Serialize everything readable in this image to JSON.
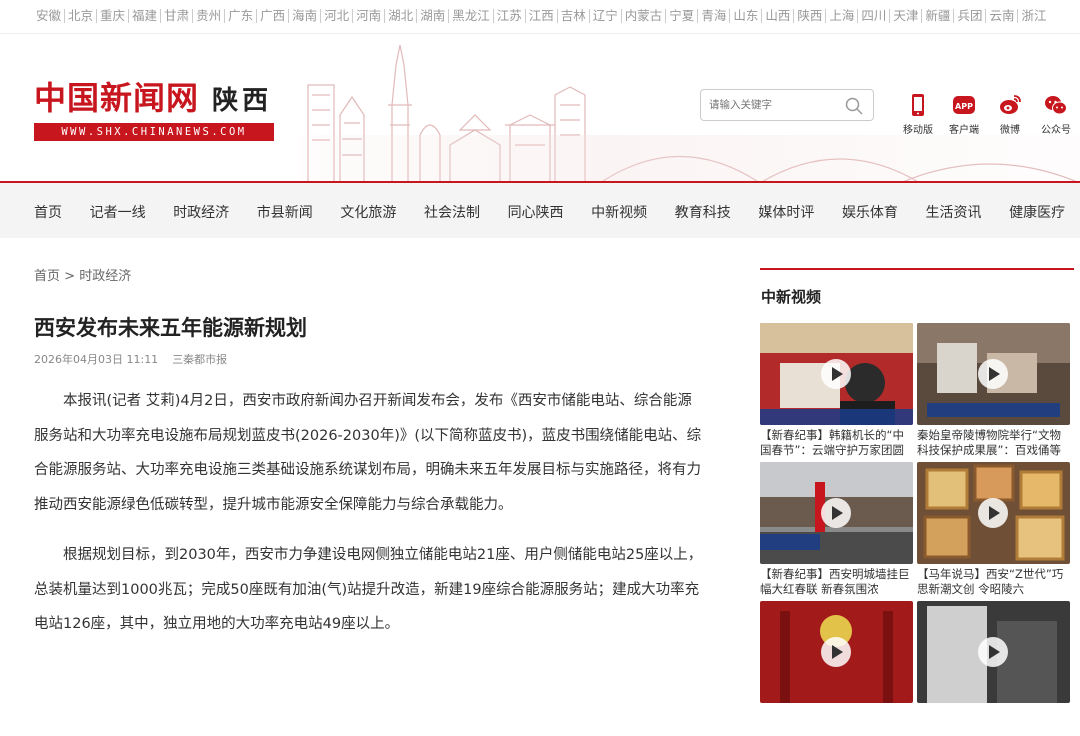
{
  "provinces": [
    "安徽",
    "北京",
    "重庆",
    "福建",
    "甘肃",
    "贵州",
    "广东",
    "广西",
    "海南",
    "河北",
    "河南",
    "湖北",
    "湖南",
    "黑龙江",
    "江苏",
    "江西",
    "吉林",
    "辽宁",
    "内蒙古",
    "宁夏",
    "青海",
    "山东",
    "山西",
    "陕西",
    "上海",
    "四川",
    "天津",
    "新疆",
    "兵团",
    "云南",
    "浙江"
  ],
  "header": {
    "logo_text": "中国新闻网",
    "region": "陕西",
    "url_text": "WWW.SHX.CHINANEWS.COM",
    "search_placeholder": "请输入关键字",
    "quick_links": [
      {
        "label": "移动版",
        "icon": "mobile-icon"
      },
      {
        "label": "客户端",
        "icon": "app-icon"
      },
      {
        "label": "微博",
        "icon": "weibo-icon"
      },
      {
        "label": "公众号",
        "icon": "wechat-icon"
      }
    ]
  },
  "nav": {
    "items": [
      "首页",
      "记者一线",
      "时政经济",
      "市县新闻",
      "文化旅游",
      "社会法制",
      "同心陕西",
      "中新视频",
      "教育科技",
      "媒体时评",
      "娱乐体育",
      "生活资讯",
      "健康医疗"
    ]
  },
  "breadcrumb": {
    "home": "首页",
    "separator": " > ",
    "current": "时政经济"
  },
  "article": {
    "title": "西安发布未来五年能源新规划",
    "date": "2026年04月03日 11:11",
    "source": "三秦都市报",
    "paragraphs": [
      "本报讯(记者 艾莉)4月2日，西安市政府新闻办召开新闻发布会，发布《西安市储能电站、综合能源服务站和大功率充电设施布局规划蓝皮书(2026-2030年)》(以下简称蓝皮书)，蓝皮书围绕储能电站、综合能源服务站、大功率充电设施三类基础设施系统谋划布局，明确未来五年发展目标与实施路径，将有力推动西安能源绿色低碳转型，提升城市能源安全保障能力与综合承载能力。",
      "根据规划目标，到2030年，西安市力争建设电网侧独立储能电站21座、用户侧储能电站25座以上，总装机量达到1000兆瓦；完成50座既有加油(气)站提升改造，新建19座综合能源服务站；建成大功率充电站126座，其中，独立用地的大功率充电站49座以上。"
    ]
  },
  "sidebar": {
    "title": "中新视频",
    "videos": [
      {
        "caption": "【新春纪事】韩籍机长的“中国春节”：云端守护万家团圆"
      },
      {
        "caption": "秦始皇帝陵博物院举行“文物科技保护成果展”：百戏俑等珍..."
      },
      {
        "caption": "【新春纪事】西安明城墙挂巨幅大红春联 新春氛围浓"
      },
      {
        "caption": "【马年说马】西安“Z世代”巧思新潮文创 令昭陵六骏“跃”入..."
      },
      {
        "caption": ""
      },
      {
        "caption": ""
      }
    ]
  },
  "colors": {
    "brand_red": "#c8161e",
    "nav_bg": "#f4f4f4"
  }
}
